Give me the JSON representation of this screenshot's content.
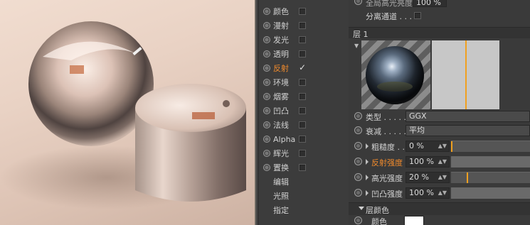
{
  "channels": [
    {
      "label": "颜色",
      "checked": false,
      "active": false
    },
    {
      "label": "漫射",
      "checked": false,
      "active": false
    },
    {
      "label": "发光",
      "checked": false,
      "active": false
    },
    {
      "label": "透明",
      "checked": false,
      "active": false
    },
    {
      "label": "反射",
      "checked": true,
      "active": true
    },
    {
      "label": "环境",
      "checked": false,
      "active": false
    },
    {
      "label": "烟雾",
      "checked": false,
      "active": false
    },
    {
      "label": "凹凸",
      "checked": false,
      "active": false
    },
    {
      "label": "法线",
      "checked": false,
      "active": false
    },
    {
      "label": "Alpha",
      "checked": false,
      "active": false
    },
    {
      "label": "辉光",
      "checked": false,
      "active": false
    },
    {
      "label": "置换",
      "checked": false,
      "active": false
    },
    {
      "label": "编辑",
      "checked": null,
      "active": false
    },
    {
      "label": "光照",
      "checked": null,
      "active": false
    },
    {
      "label": "指定",
      "checked": null,
      "active": false
    }
  ],
  "check_mark": "✓",
  "attributes": {
    "top_partial_label": "全局高光亮度",
    "top_partial_value": "100 %",
    "separate_pass_label": "分离通道 . . . .",
    "layer_title": "层 1",
    "type_label": "类型 . . . . . .",
    "type_value": "GGX",
    "attenuation_label": "衰减 . . . . . .",
    "attenuation_value": "平均",
    "roughness_label": "粗糙度 . .",
    "roughness_value": "0 %",
    "roughness_fraction": 0.0,
    "reflect_strength_label": "反射强度",
    "reflect_strength_value": "100 %",
    "reflect_strength_fraction": 1.0,
    "specular_label": "高光强度",
    "specular_value": "20 %",
    "specular_fraction": 0.2,
    "bump_label": "凹凸强度",
    "bump_value": "100 %",
    "bump_fraction": 1.0,
    "layer_color_section": "层颜色",
    "color_label": "颜色"
  },
  "colors": {
    "accent_orange": "#f08a2c",
    "slider_marker": "#f0a020",
    "panel_bg": "#3a3a3a"
  }
}
